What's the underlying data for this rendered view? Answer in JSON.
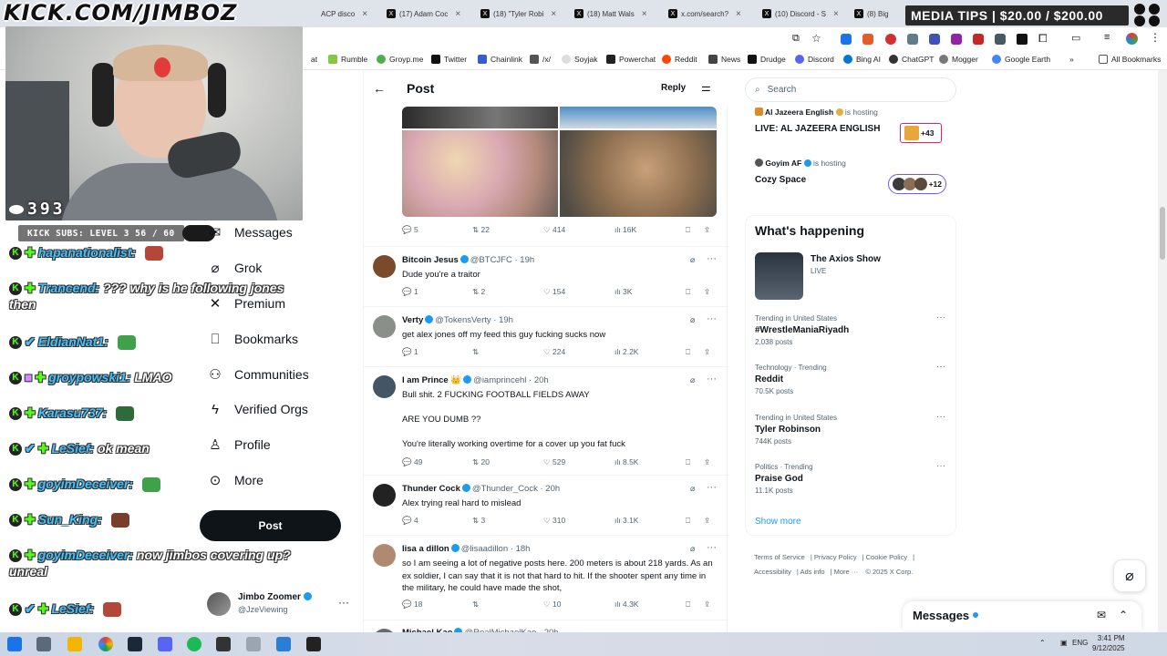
{
  "stream": {
    "channel_url": "KICK.COM/JIMBOZ",
    "viewer_count": "393",
    "subs_goal": "KICK SUBS: LEVEL 3 56 / 60",
    "media_tips": "MEDIA TIPS | $20.00 / $200.00"
  },
  "chat": [
    {
      "user": "hapanationalist:",
      "message": ""
    },
    {
      "user": "Trancend:",
      "message": "??? why is he following jones then"
    },
    {
      "user": "EldianNat1:",
      "message": ""
    },
    {
      "user": "groypowski1:",
      "message": "LMAO"
    },
    {
      "user": "Karasu737:",
      "message": ""
    },
    {
      "user": "LeSief:",
      "message": "ok mean"
    },
    {
      "user": "goyimDeceiver:",
      "message": ""
    },
    {
      "user": "Sun_King:",
      "message": ""
    },
    {
      "user": "goyimDeceiver:",
      "message": "now jimbos covering up? unreal"
    },
    {
      "user": "LeSief:",
      "message": ""
    }
  ],
  "browser": {
    "tabs": [
      "ACP disco",
      "(17) Adam Coc",
      "(18) \"Tyler Robi",
      "(18) Matt Wals",
      "x.com/search?",
      "(10) Discord - S",
      "(8) Big"
    ],
    "bookmarks": [
      "at",
      "Rumble",
      "Groyp.me",
      "Twitter",
      "Chainlink",
      "/x/",
      "Soyjak",
      "Powerchat",
      "Reddit",
      "News",
      "Drudge",
      "Discord",
      "Bing AI",
      "ChatGPT",
      "Mogger",
      "Google Earth",
      "All Bookmarks"
    ]
  },
  "nav": {
    "items": [
      "Messages",
      "Grok",
      "Premium",
      "Bookmarks",
      "Communities",
      "Verified Orgs",
      "Profile",
      "More"
    ],
    "post_label": "Post",
    "account": {
      "name": "Jimbo Zoomer",
      "handle": "@JzeViewing"
    }
  },
  "main": {
    "header_title": "Post",
    "reply_label": "Reply",
    "top_stats": {
      "replies": "5",
      "reposts": "22",
      "likes": "414",
      "views": "16K"
    },
    "tweets": [
      {
        "name": "Bitcoin Jesus",
        "handle": "@BTCJFC",
        "time": "19h",
        "text": "Dude you're a traitor",
        "replies": "1",
        "reposts": "2",
        "likes": "154",
        "views": "3K"
      },
      {
        "name": "Verty",
        "handle": "@TokensVerty",
        "time": "19h",
        "text": "get alex jones off my feed this guy fucking sucks now",
        "replies": "1",
        "reposts": "",
        "likes": "224",
        "views": "2.2K"
      },
      {
        "name": "I am Prince 👑",
        "handle": "@iamprincehl",
        "time": "20h",
        "text": "Bull shit. 2 FUCKING FOOTBALL FIELDS AWAY\n\nARE YOU DUMB ??\n\nYou're literally working overtime for a cover up you fat fuck",
        "replies": "49",
        "reposts": "20",
        "likes": "529",
        "views": "8.5K"
      },
      {
        "name": "Thunder Cock",
        "handle": "@Thunder_Cock",
        "time": "20h",
        "text": "Alex trying real hard to mislead",
        "replies": "4",
        "reposts": "3",
        "likes": "310",
        "views": "3.1K"
      },
      {
        "name": "lisa a dillon",
        "handle": "@lisaadillon",
        "time": "18h",
        "text": "so I am seeing a lot of negative posts here. 200 meters is about 218 yards. As an ex soldier, I can say that it is not that hard to hit. If the shooter spent any time in the military, he could have made the shot,",
        "replies": "18",
        "reposts": "",
        "likes": "10",
        "views": "4.3K"
      },
      {
        "name": "Michael Kao",
        "handle": "@RealMichaelKao",
        "time": "20h",
        "text": "",
        "replies": "",
        "reposts": "",
        "likes": "",
        "views": ""
      }
    ]
  },
  "right": {
    "search_placeholder": "Search",
    "spaces": [
      {
        "host": "Al Jazeera English",
        "status": "is hosting",
        "title": "LIVE: AL JAZEERA ENGLISH",
        "count": "+43"
      },
      {
        "host": "Goyim AF",
        "status": "is hosting",
        "title": "Cozy Space",
        "count": "+12"
      }
    ],
    "happening_title": "What's happening",
    "live": {
      "title": "The Axios Show",
      "status": "LIVE"
    },
    "trends": [
      {
        "context": "Trending in United States",
        "topic": "#WrestleManiaRiyadh",
        "posts": "2,038 posts"
      },
      {
        "context": "Technology · Trending",
        "topic": "Reddit",
        "posts": "70.5K posts"
      },
      {
        "context": "Trending in United States",
        "topic": "Tyler Robinson",
        "posts": "744K posts"
      },
      {
        "context": "Politics · Trending",
        "topic": "Praise God",
        "posts": "11.1K posts"
      }
    ],
    "show_more": "Show more",
    "footer": [
      "Terms of Service",
      "Privacy Policy",
      "Cookie Policy",
      "Accessibility",
      "Ads info",
      "More ···",
      "© 2025 X Corp."
    ],
    "messages_label": "Messages"
  },
  "taskbar": {
    "lang": "ENG",
    "time": "3:41 PM",
    "date": "9/12/2025"
  },
  "colors": {
    "accent": "#1d9bf0",
    "kick_green": "#53fc18",
    "chat_user": "#44c2ff"
  }
}
